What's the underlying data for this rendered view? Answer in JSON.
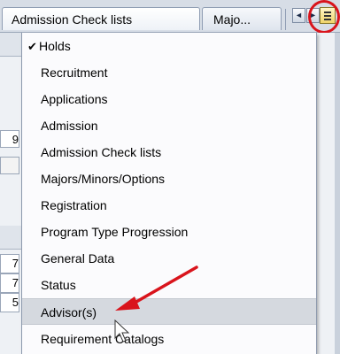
{
  "tabs": [
    {
      "label": "Admission Check lists",
      "active": true
    },
    {
      "label": "Majo...",
      "active": false
    }
  ],
  "tab_nav": {
    "prev_icon": "◄",
    "next_icon": "►"
  },
  "menu": {
    "items": [
      {
        "label": "Holds",
        "checked": true
      },
      {
        "label": "Recruitment"
      },
      {
        "label": "Applications"
      },
      {
        "label": "Admission"
      },
      {
        "label": "Admission Check lists"
      },
      {
        "label": "Majors/Minors/Options"
      },
      {
        "label": "Registration"
      },
      {
        "label": "Program Type Progression"
      },
      {
        "label": "General Data"
      },
      {
        "label": "Status"
      },
      {
        "label": "Advisor(s)",
        "highlighted": true
      },
      {
        "label": "Requirement Catalogs"
      }
    ],
    "check_glyph": "✔"
  },
  "background_fields": [
    "9",
    "7",
    "7",
    "5"
  ],
  "colors": {
    "annotation_red": "#d9141c",
    "menu_highlight": "#d5d9df"
  }
}
